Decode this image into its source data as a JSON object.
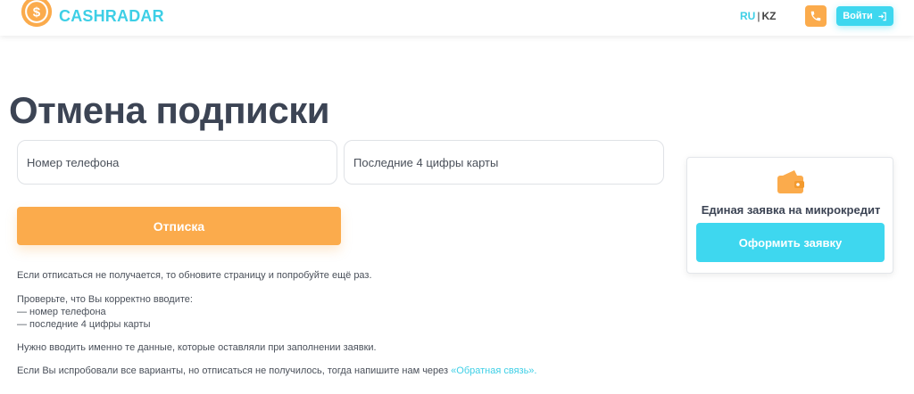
{
  "header": {
    "brand": "CASHRADAR",
    "lang_ru": "RU",
    "lang_separator": "|",
    "lang_kz": "KZ",
    "login_label": "Войти"
  },
  "main": {
    "title": "Отмена подписки",
    "phone_placeholder": "Номер телефона",
    "card_placeholder": "Последние 4 цифры карты",
    "unsubscribe_label": "Отписка",
    "notes": {
      "refresh": "Если отписаться не получается, то обновите страницу и попробуйте ещё раз.",
      "check_intro": "Проверьте, что Вы корректно вводите:",
      "check_phone": "— номер телефона",
      "check_card": "— последние 4 цифры карты",
      "same_data": "Нужно вводить именно те данные, которые оставляли при заполнении заявки.",
      "contact_prefix": "Если Вы испробовали все варианты, но отписаться не получилось, тогда напишите нам через ",
      "contact_link": "«Обратная связь»."
    }
  },
  "sidebar": {
    "title": "Единая заявка на микрокредит",
    "apply_label": "Оформить заявку"
  },
  "icons": {
    "logo": "dollar-coin-icon",
    "phone": "phone-icon",
    "login": "login-arrow-icon",
    "wallet": "wallet-icon"
  },
  "colors": {
    "accent_cyan": "#3ed7ef",
    "accent_orange": "#fbab4c",
    "title_dark": "#3c4454"
  }
}
